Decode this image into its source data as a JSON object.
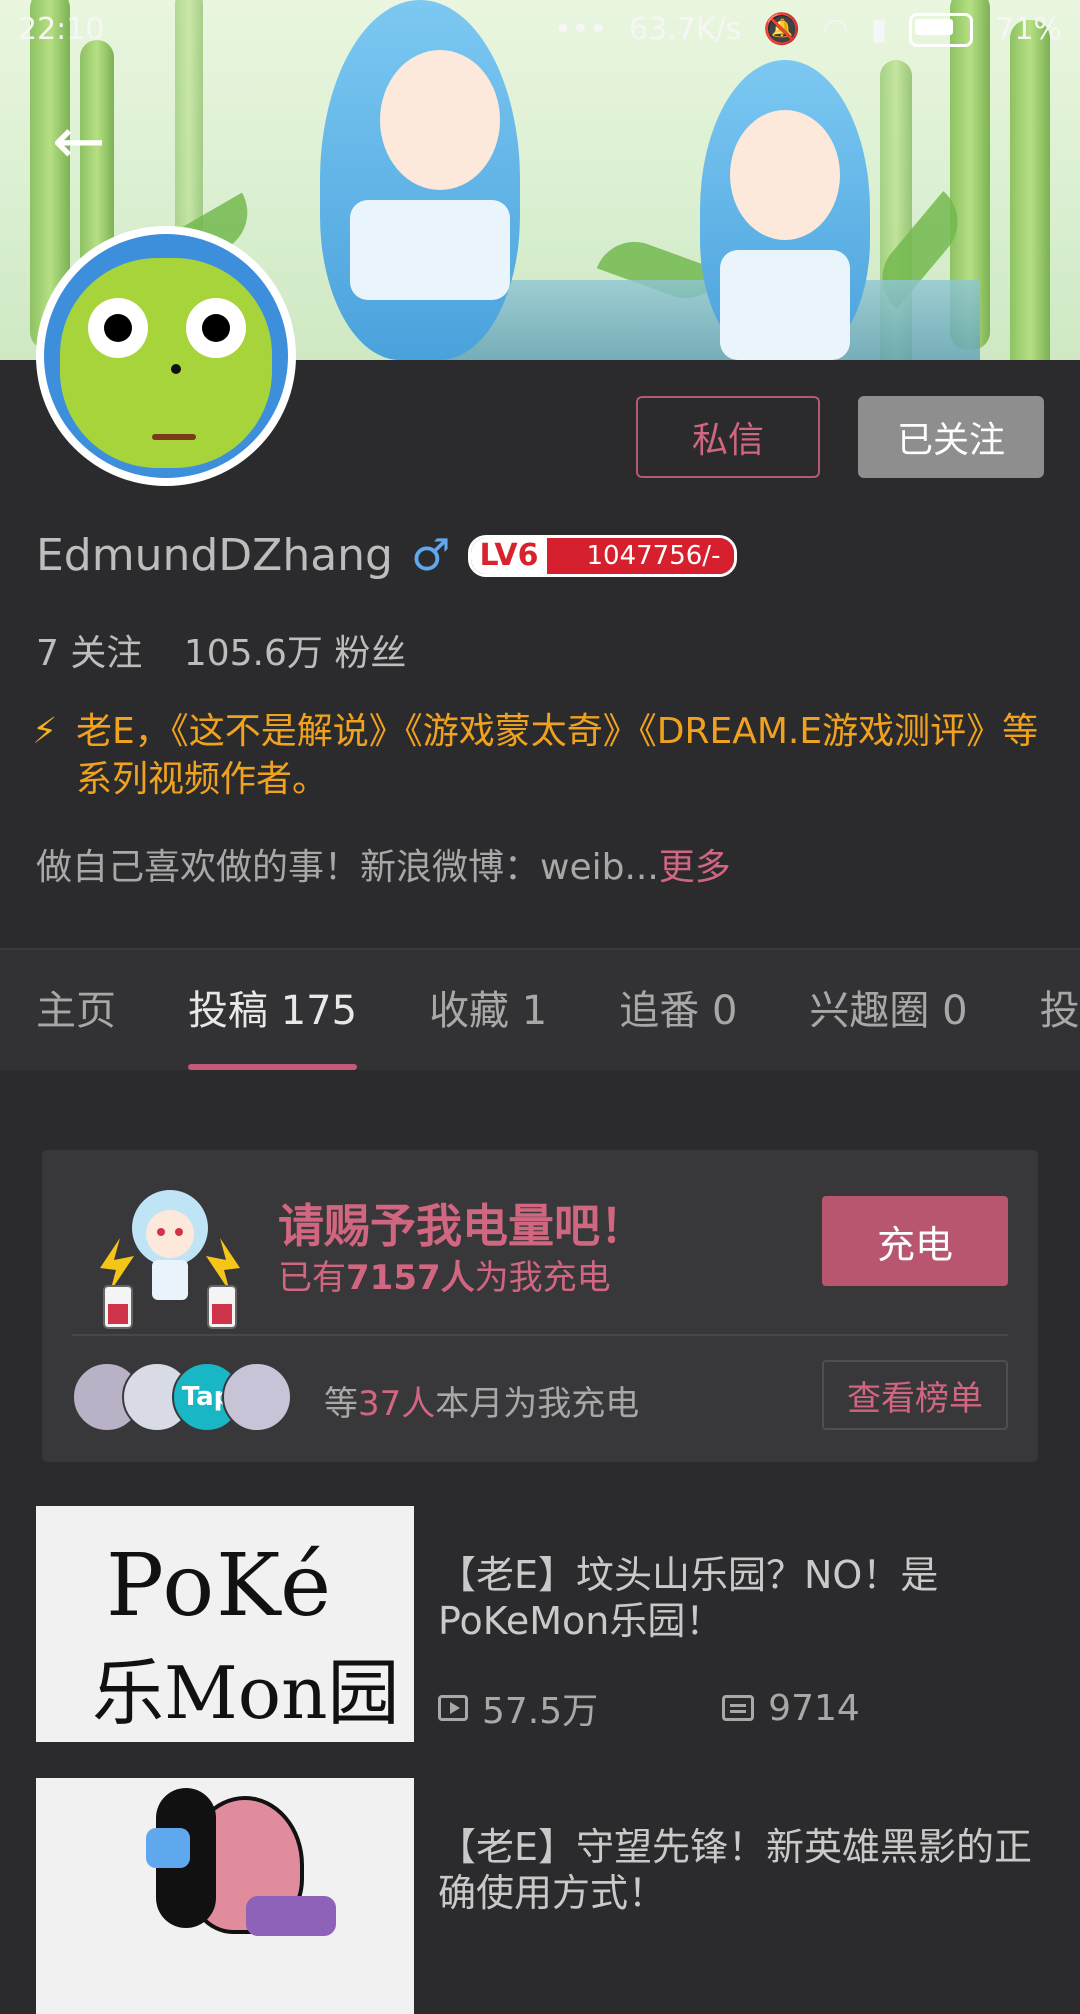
{
  "status_bar": {
    "time": "22:10",
    "net_speed": "63.7K/s",
    "battery": "71%"
  },
  "profile": {
    "username": "EdmundDZhang",
    "gender_symbol": "♂",
    "level": "LV6",
    "exp": "1047756/-",
    "following": "7 关注",
    "followers": "105.6万 粉丝",
    "cert_text": "老E，《这不是解说》《游戏蒙太奇》《DREAM.E游戏测评》等系列视频作者。",
    "bio": "做自己喜欢做的事！新浪微博：weib...",
    "bio_more": "更多",
    "btn_message": "私信",
    "btn_followed": "已关注"
  },
  "tabs": [
    {
      "label": "主页"
    },
    {
      "label": "投稿 175"
    },
    {
      "label": "收藏 1"
    },
    {
      "label": "追番 0"
    },
    {
      "label": "兴趣圈 0"
    },
    {
      "label": "投"
    }
  ],
  "charge": {
    "title": "请赐予我电量吧！",
    "sub_prefix": "已有",
    "sub_count": "7157人",
    "sub_suffix": "为我充电",
    "button": "充电",
    "count_prefix": "等",
    "count_num": "37人",
    "count_suffix": "本月为我充电",
    "rank_button": "查看榜单",
    "avatar_labels": [
      "",
      "",
      "Tap",
      ""
    ]
  },
  "videos": [
    {
      "title": "【老E】坟头山乐园？NO！是PoKeMon乐园！",
      "views": "57.5万",
      "danmaku": "9714",
      "thumb_text_top": "PoKé",
      "thumb_text_bottom": "乐Mon园"
    },
    {
      "title": "【老E】守望先锋！新英雄黑影的正确使用方式！",
      "views": "",
      "danmaku": ""
    }
  ],
  "colors": {
    "accent": "#d0667f",
    "cert": "#f0a21e",
    "background": "#2b2b2d"
  },
  "icons": [
    "back-arrow-icon",
    "male-icon",
    "bolt-icon",
    "play-icon",
    "danmaku-icon",
    "wifi-icon",
    "signal-icon",
    "battery-icon",
    "mute-icon"
  ]
}
